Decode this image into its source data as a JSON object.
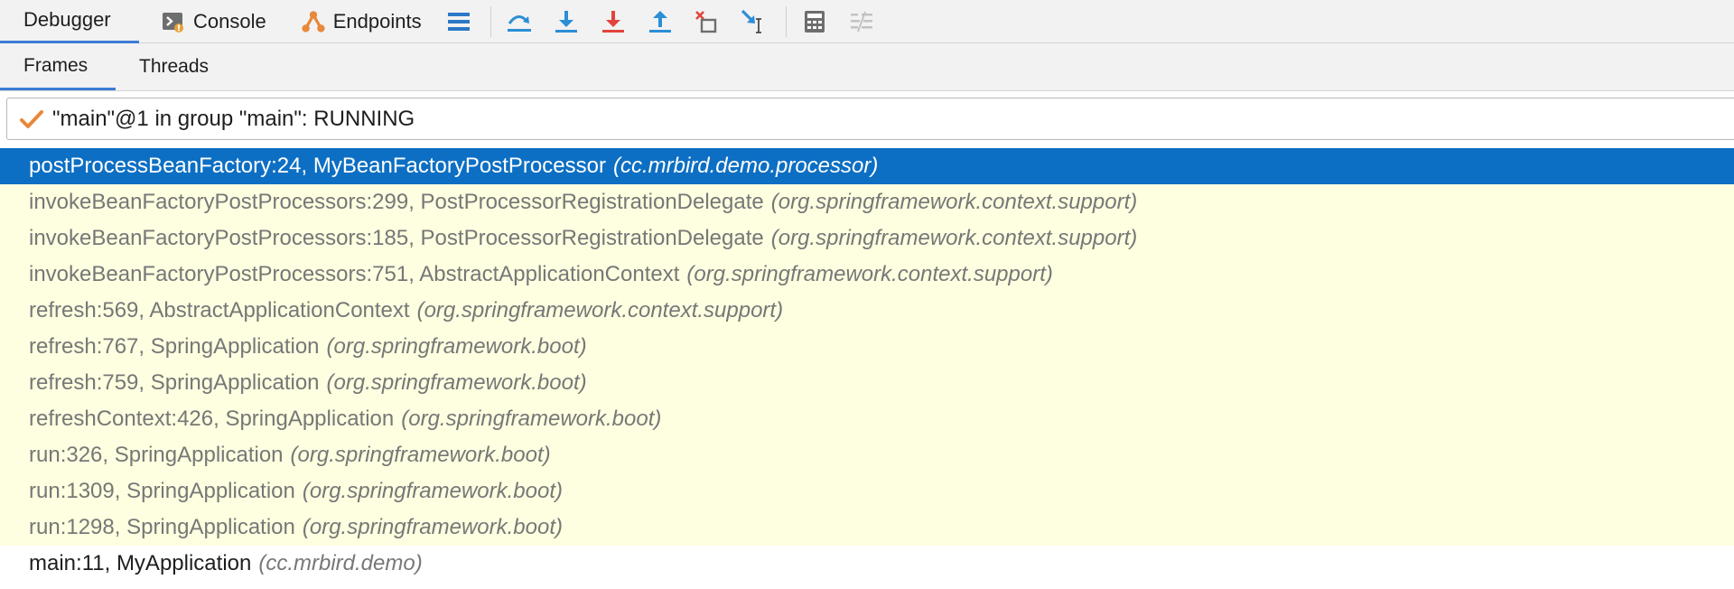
{
  "toolbar": {
    "tabs": [
      {
        "label": "Debugger",
        "active": true
      },
      {
        "label": "Console",
        "active": false,
        "icon": "console-icon"
      },
      {
        "label": "Endpoints",
        "active": false,
        "icon": "endpoints-icon"
      }
    ],
    "buttons": [
      "hamburger-icon",
      "step-over-icon",
      "step-into-icon",
      "force-step-into-icon",
      "step-out-icon",
      "drop-frame-icon",
      "run-to-cursor-icon",
      "evaluate-icon",
      "trace-icon"
    ],
    "colors": {
      "accent": "#3d7dd6",
      "blue": "#2b8ed6",
      "red": "#e0443c",
      "orange": "#e8883a"
    }
  },
  "subtabs": [
    {
      "label": "Frames",
      "active": true
    },
    {
      "label": "Threads",
      "active": false
    }
  ],
  "thread": {
    "status_icon": "check-icon",
    "label": "\"main\"@1 in group \"main\": RUNNING"
  },
  "frames": [
    {
      "method": "postProcessBeanFactory:24, MyBeanFactoryPostProcessor",
      "package": "(cc.mrbird.demo.processor)"
    },
    {
      "method": "invokeBeanFactoryPostProcessors:299, PostProcessorRegistrationDelegate",
      "package": "(org.springframework.context.support)"
    },
    {
      "method": "invokeBeanFactoryPostProcessors:185, PostProcessorRegistrationDelegate",
      "package": "(org.springframework.context.support)"
    },
    {
      "method": "invokeBeanFactoryPostProcessors:751, AbstractApplicationContext",
      "package": "(org.springframework.context.support)"
    },
    {
      "method": "refresh:569, AbstractApplicationContext",
      "package": "(org.springframework.context.support)"
    },
    {
      "method": "refresh:767, SpringApplication",
      "package": "(org.springframework.boot)"
    },
    {
      "method": "refresh:759, SpringApplication",
      "package": "(org.springframework.boot)"
    },
    {
      "method": "refreshContext:426, SpringApplication",
      "package": "(org.springframework.boot)"
    },
    {
      "method": "run:326, SpringApplication",
      "package": "(org.springframework.boot)"
    },
    {
      "method": "run:1309, SpringApplication",
      "package": "(org.springframework.boot)"
    },
    {
      "method": "run:1298, SpringApplication",
      "package": "(org.springframework.boot)"
    },
    {
      "method": "main:11, MyApplication",
      "package": "(cc.mrbird.demo)"
    }
  ],
  "selected_frame_index": 0,
  "colors": {
    "selection": "#0d6fc3",
    "library_frame_bg": "#fefee0",
    "library_frame_text": "#777777"
  }
}
